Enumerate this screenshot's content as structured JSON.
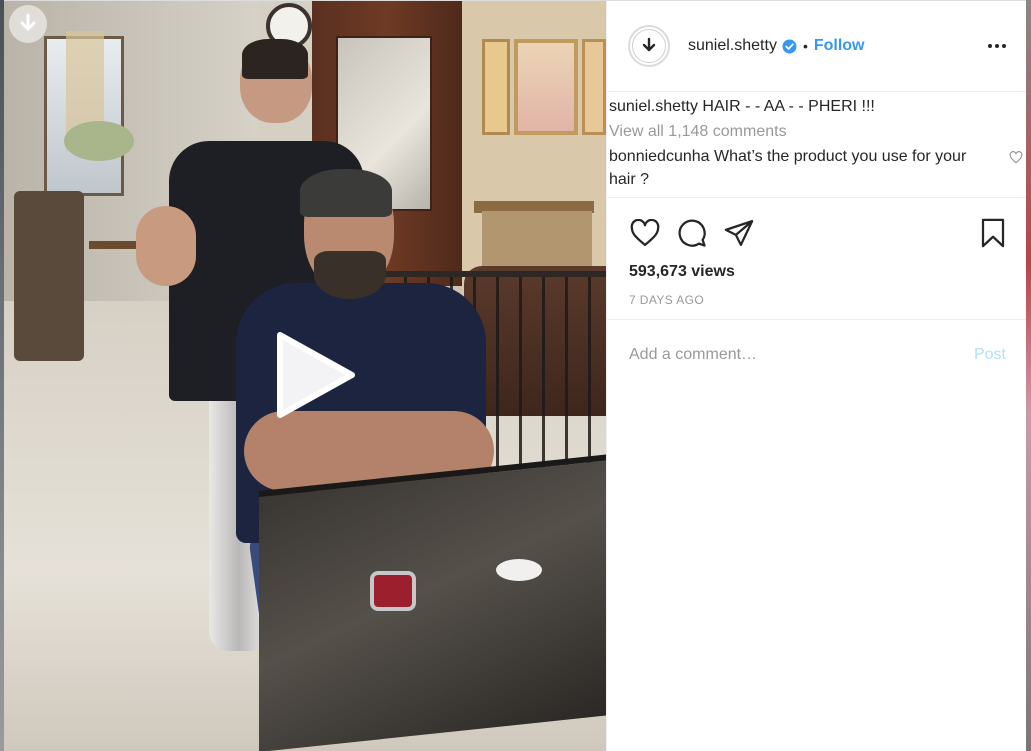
{
  "post": {
    "author": {
      "username": "suniel.shetty",
      "verified": true,
      "avatar_icon": "download-arrow-icon"
    },
    "follow_label": "Follow",
    "separator": "•",
    "caption": {
      "username": "suniel.shetty",
      "text": "HAIR - - AA - - PHERI !!!"
    },
    "view_all_comments": "View all 1,148 comments",
    "comments": [
      {
        "username": "bonniedcunha",
        "text": "What’s the product you use for your hair ?"
      }
    ],
    "views": "593,673 views",
    "time_ago": "7 DAYS AGO",
    "add_comment_placeholder": "Add a comment…",
    "post_label": "Post"
  },
  "colors": {
    "accent": "#3897f0",
    "post_disabled": "#b2dffc",
    "secondary_text": "#999999"
  },
  "icons": {
    "video_download": "download-icon",
    "play": "play-icon",
    "like": "heart-icon",
    "comment": "comment-icon",
    "share": "share-icon",
    "save": "bookmark-icon",
    "more": "more-options-icon"
  }
}
